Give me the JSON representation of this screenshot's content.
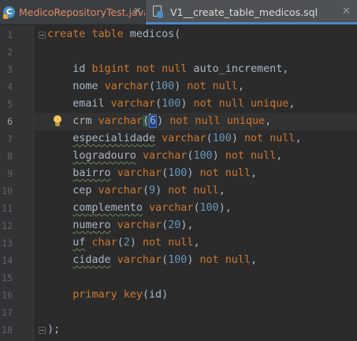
{
  "tabs": [
    {
      "label": "MedicoRepositoryTest.java",
      "icon": "java-class-icon",
      "active": false,
      "color": "#e08a6b"
    },
    {
      "label": "V1__create_table_medicos.sql",
      "icon": "sql-file-icon",
      "active": true
    }
  ],
  "editor": {
    "current_line": 6,
    "lines": [
      {
        "n": "1",
        "tokens": [
          [
            "kw",
            "create"
          ],
          [
            "t",
            " "
          ],
          [
            "kw",
            "table"
          ],
          [
            "t",
            " medicos("
          ]
        ]
      },
      {
        "n": "2",
        "tokens": []
      },
      {
        "n": "3",
        "tokens": [
          [
            "t",
            "    id "
          ],
          [
            "kw",
            "bigint"
          ],
          [
            "t",
            " "
          ],
          [
            "kw",
            "not null"
          ],
          [
            "t",
            " auto_increment,"
          ]
        ]
      },
      {
        "n": "4",
        "tokens": [
          [
            "t",
            "    nome "
          ],
          [
            "kw",
            "varchar"
          ],
          [
            "t",
            "("
          ],
          [
            "num",
            "100"
          ],
          [
            "t",
            ") "
          ],
          [
            "kw",
            "not null"
          ],
          [
            "t",
            ","
          ]
        ]
      },
      {
        "n": "5",
        "tokens": [
          [
            "t",
            "    email "
          ],
          [
            "kw",
            "varchar"
          ],
          [
            "t",
            "("
          ],
          [
            "num",
            "100"
          ],
          [
            "t",
            ") "
          ],
          [
            "kw",
            "not null unique"
          ],
          [
            "t",
            ","
          ]
        ]
      },
      {
        "n": "6",
        "tokens": [
          [
            "t",
            "    crm "
          ],
          [
            "kw",
            "varchar"
          ],
          [
            "bracket",
            "("
          ],
          [
            "caret",
            "6"
          ],
          [
            "t",
            ") "
          ],
          [
            "kw",
            "not null unique"
          ],
          [
            "t",
            ","
          ]
        ]
      },
      {
        "n": "7",
        "tokens": [
          [
            "t",
            "    "
          ],
          [
            "typo",
            "especialidade"
          ],
          [
            "t",
            " "
          ],
          [
            "kw",
            "varchar"
          ],
          [
            "t",
            "("
          ],
          [
            "num",
            "100"
          ],
          [
            "t",
            ") "
          ],
          [
            "kw",
            "not null"
          ],
          [
            "t",
            ","
          ]
        ]
      },
      {
        "n": "8",
        "tokens": [
          [
            "t",
            "    "
          ],
          [
            "typo",
            "logradouro"
          ],
          [
            "t",
            " "
          ],
          [
            "kw",
            "varchar"
          ],
          [
            "t",
            "("
          ],
          [
            "num",
            "100"
          ],
          [
            "t",
            ") "
          ],
          [
            "kw",
            "not null"
          ],
          [
            "t",
            ","
          ]
        ]
      },
      {
        "n": "9",
        "tokens": [
          [
            "t",
            "    "
          ],
          [
            "typo",
            "bairro"
          ],
          [
            "t",
            " "
          ],
          [
            "kw",
            "varchar"
          ],
          [
            "t",
            "("
          ],
          [
            "num",
            "100"
          ],
          [
            "t",
            ") "
          ],
          [
            "kw",
            "not null"
          ],
          [
            "t",
            ","
          ]
        ]
      },
      {
        "n": "10",
        "tokens": [
          [
            "t",
            "    cep "
          ],
          [
            "kw",
            "varchar"
          ],
          [
            "t",
            "("
          ],
          [
            "num",
            "9"
          ],
          [
            "t",
            ") "
          ],
          [
            "kw",
            "not null"
          ],
          [
            "t",
            ","
          ]
        ]
      },
      {
        "n": "11",
        "tokens": [
          [
            "t",
            "    "
          ],
          [
            "typo",
            "complemento"
          ],
          [
            "t",
            " "
          ],
          [
            "kw",
            "varchar"
          ],
          [
            "t",
            "("
          ],
          [
            "num",
            "100"
          ],
          [
            "t",
            "),"
          ]
        ]
      },
      {
        "n": "12",
        "tokens": [
          [
            "t",
            "    "
          ],
          [
            "typo",
            "numero"
          ],
          [
            "t",
            " "
          ],
          [
            "kw",
            "varchar"
          ],
          [
            "t",
            "("
          ],
          [
            "num",
            "20"
          ],
          [
            "t",
            "),"
          ]
        ]
      },
      {
        "n": "13",
        "tokens": [
          [
            "t",
            "    "
          ],
          [
            "typo",
            "uf"
          ],
          [
            "t",
            " "
          ],
          [
            "kw",
            "char"
          ],
          [
            "t",
            "("
          ],
          [
            "num",
            "2"
          ],
          [
            "t",
            ") "
          ],
          [
            "kw",
            "not null"
          ],
          [
            "t",
            ","
          ]
        ]
      },
      {
        "n": "14",
        "tokens": [
          [
            "t",
            "    "
          ],
          [
            "typo",
            "cidade"
          ],
          [
            "t",
            " "
          ],
          [
            "kw",
            "varchar"
          ],
          [
            "t",
            "("
          ],
          [
            "num",
            "100"
          ],
          [
            "t",
            ") "
          ],
          [
            "kw",
            "not null"
          ],
          [
            "t",
            ","
          ]
        ]
      },
      {
        "n": "15",
        "tokens": []
      },
      {
        "n": "16",
        "tokens": [
          [
            "t",
            "    "
          ],
          [
            "kw",
            "primary key"
          ],
          [
            "t",
            "(id)"
          ]
        ]
      },
      {
        "n": "17",
        "tokens": []
      },
      {
        "n": "18",
        "tokens": [
          [
            "t",
            ");"
          ]
        ]
      }
    ]
  },
  "gutter_icons": {
    "fold": "fold-marker-icon",
    "intention": "lightbulb-icon"
  },
  "colors": {
    "background": "#2b2b2b",
    "keyword": "#cc7832",
    "number": "#6897bb",
    "text": "#a9b7c6",
    "accent": "#4a88c7"
  }
}
